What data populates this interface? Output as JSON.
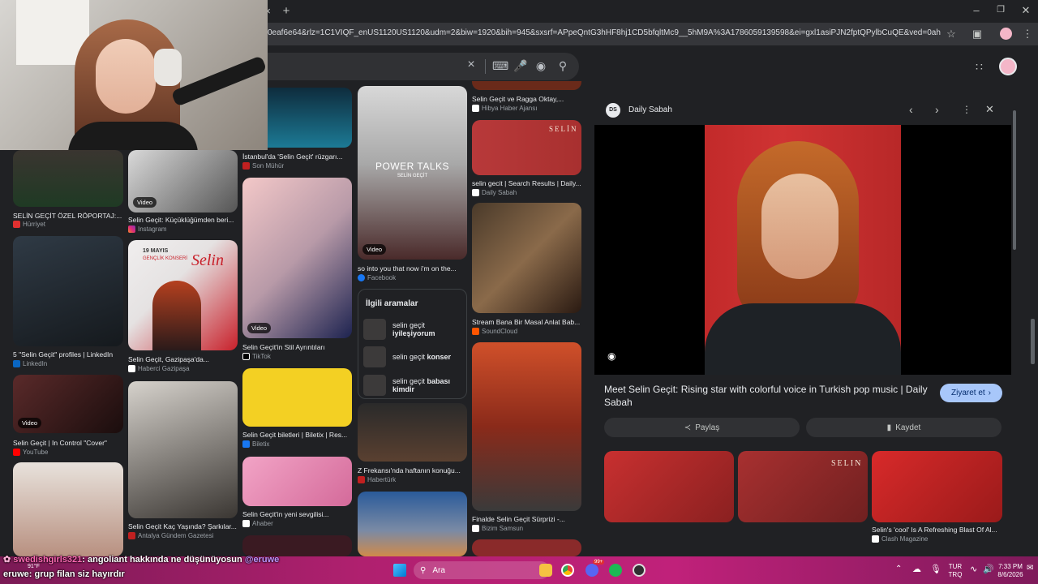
{
  "browser": {
    "url": "0eaf6e64&rlz=1C1VIQF_enUS1120US1120&udm=2&biw=1920&bih=945&sxsrf=APpeQntG3hHF8hj1CD5bfqltMc9__5hM9A%3A1786059139598&ei=gxl1asiPJN2fptQPylbCuQE&ved=0ahUKEwil3cDkll...",
    "new_tab": "+",
    "close_tab": "×"
  },
  "search": {
    "clear": "×"
  },
  "results": {
    "col1": [
      {
        "title": "SELİN GEÇİT ÖZEL RÖPORTAJ:...",
        "source": "Hürriyet"
      },
      {
        "title": "5 \"Selin Geçit\" profiles | LinkedIn",
        "source": "LinkedIn"
      },
      {
        "title": "Selin Geçit | In Control \"Cover\"",
        "source": "YouTube",
        "badge": "Video"
      }
    ],
    "col2": [
      {
        "title": "Selin Geçit: Küçüklüğümden beri...",
        "source": "Instagram",
        "badge": "Video"
      },
      {
        "title": "Selin Geçit, Gazipaşa'da...",
        "source": "Haberci Gazipaşa"
      },
      {
        "title": "Selin Geçit Kaç Yaşında? Şarkılar...",
        "source": "Antalya Gündem Gazetesi"
      }
    ],
    "col3": [
      {
        "title": "İstanbul'da 'Selin Geçit' rüzgarı...",
        "source": "Son Mühür"
      },
      {
        "title": "Selin Geçit'in Stil Ayrıntıları",
        "source": "TikTok",
        "badge": "Video"
      },
      {
        "title": "Selin Geçit biletleri | Biletix | Res...",
        "source": "Biletix"
      },
      {
        "title": "Selin Geçit'in yeni sevgilisi...",
        "source": "Ahaber"
      }
    ],
    "col4": [
      {
        "title": "so into you that now i'm on the...",
        "source": "Facebook",
        "badge": "Video"
      },
      {
        "title": "Z Frekansı'nda haftanın konuğu...",
        "source": "Habertürk"
      }
    ],
    "col5": [
      {
        "title": "Selin Geçit ve Ragga Oktay,...",
        "source": "Hibya Haber Ajansı"
      },
      {
        "title": "selin gecit | Search Results | Daily...",
        "source": "Daily Sabah"
      },
      {
        "title": "Stream Bana Bir Masal Anlat Bab...",
        "source": "SoundCloud"
      },
      {
        "title": "Finalde Selin Geçit Sürprizi -...",
        "source": "Bizim Samsun"
      }
    ],
    "power_talks": "POWER TALKS",
    "power_talks_sub": "SELİN GEÇİT",
    "concert_poster": "Selin",
    "concert_date": "19 MAYIS",
    "concert_sub": "GENÇLİK KONSERİ",
    "selin_wordmark": "SELİN"
  },
  "related": {
    "title": "İlgili aramalar",
    "items": [
      {
        "prefix": "selin geçit",
        "bold": "iyileşiyorum"
      },
      {
        "prefix": "selin geçit",
        "bold": "konser"
      },
      {
        "prefix": "selin geçit",
        "bold": "babası kimdir"
      }
    ]
  },
  "panel": {
    "source_logo": "DS",
    "source_name": "Daily Sabah",
    "title": "Meet Selin Geçit: Rising star with colorful voice in Turkish pop music | Daily Sabah",
    "visit": "Ziyaret et",
    "share": "Paylaş",
    "save": "Kaydet",
    "wordmark": "SELIN",
    "similar": [
      {
        "title": "",
        "source": ""
      },
      {
        "title": "",
        "source": ""
      },
      {
        "title": "Selin's 'cool' Is A Refreshing Blast Of Al...",
        "source": "Clash Magazine"
      }
    ]
  },
  "chat": {
    "line1_user": "swedishgirls321",
    "line1_text": ": angoliant hakkında ne düşünüyosun",
    "line1_mention": "@eruwe",
    "line2_user": "eruwe",
    "line2_text": ": grup filan siz hayırdır"
  },
  "taskbar": {
    "search": "Ara",
    "weather_temp": "91°F",
    "lang1": "TUR",
    "lang2": "TRQ",
    "time": "7:33 PM",
    "date": "8/6/2026",
    "discord_badge": "99+"
  },
  "colors": {
    "accent": "#8ab4f8",
    "visit_btn": "#a8c7fa",
    "taskbar": "#b0206f",
    "chat_user1": "#ff69b4",
    "chat_mention": "#bf94ff"
  }
}
